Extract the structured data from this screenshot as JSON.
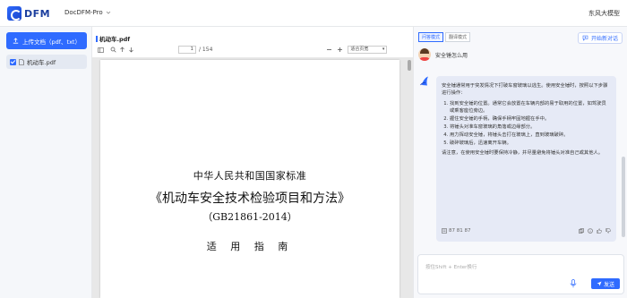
{
  "header": {
    "logo_text": "DFM",
    "app_name": "DocDFM-Pro",
    "user_name": "东风大模型"
  },
  "sidebar": {
    "upload_label": "上传文档（pdf、txt）",
    "files": [
      {
        "name": "机动车.pdf",
        "checked": true
      }
    ]
  },
  "viewer": {
    "title": "机动车.pdf",
    "current_page": "1",
    "total_pages": "/ 154",
    "zoom": "适合页宽",
    "document": {
      "line1": "中华人民共和国国家标准",
      "line2": "《机动车安全技术检验项目和方法》",
      "line3": "（GB21861-2014）",
      "line4": "适 用 指 南"
    }
  },
  "chat": {
    "mode_tabs": [
      {
        "label": "问答模式",
        "active": true
      },
      {
        "label": "翻译模式",
        "active": false
      }
    ],
    "new_chat_label": "开始新对话",
    "user_message": "安全锤怎么用",
    "answer": {
      "intro": "安全锤通常用于突发情况下打破车窗玻璃以逃生。使用安全锤时，按照以下步骤进行操作：",
      "steps": [
        "找到安全锤的位置。通常它会放置在车辆内部的易于取用的位置，如驾驶员或乘客座位旁边。",
        "握住安全锤的手柄，确保手柄牢固地握在手中。",
        "将锤头对准车窗玻璃的角落或边缘部分。",
        "用力挥动安全锤，将锤头击打在玻璃上，直到玻璃破碎。",
        "破碎玻璃后，迅速离开车辆。"
      ],
      "note": "请注意，在使用安全锤时要保持冷静，并尽量避免将锤头对准自己或其他人。",
      "footer_text": "87 81 87"
    },
    "input_placeholder": "按住Shift + Enter换行",
    "send_label": "发送"
  },
  "colors": {
    "accent": "#2f6bff",
    "answer_bg": "#e6eaf6"
  }
}
